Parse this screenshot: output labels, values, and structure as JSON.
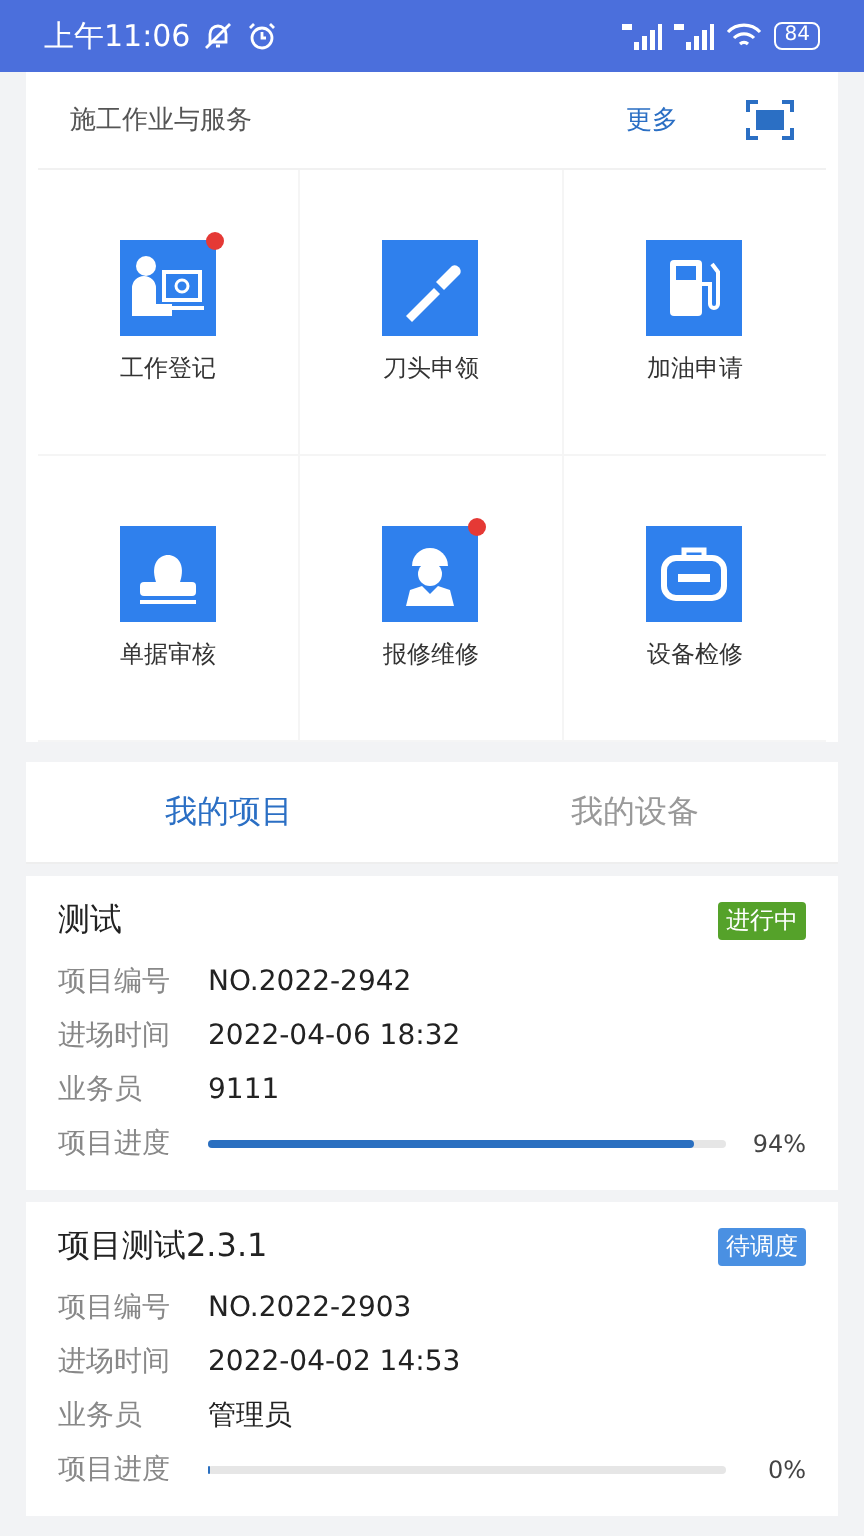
{
  "status_bar": {
    "time": "上午11:06",
    "battery": "84"
  },
  "services": {
    "title": "施工作业与服务",
    "more": "更多",
    "items": [
      {
        "label": "工作登记",
        "badge": true
      },
      {
        "label": "刀头申领",
        "badge": false
      },
      {
        "label": "加油申请",
        "badge": false
      },
      {
        "label": "单据审核",
        "badge": false
      },
      {
        "label": "报修维修",
        "badge": true
      },
      {
        "label": "设备检修",
        "badge": false
      }
    ]
  },
  "tabs": [
    {
      "label": "我的项目",
      "selected": true
    },
    {
      "label": "我的设备",
      "selected": false
    }
  ],
  "projects": [
    {
      "name": "测试",
      "status": "进行中",
      "color": "#55a22a",
      "fields": [
        {
          "label": "项目编号",
          "value": "NO.2022-2942"
        },
        {
          "label": "进场时间",
          "value": "2022-04-06 18:32"
        },
        {
          "label": "业务员",
          "value": "9111"
        }
      ],
      "progress_label": "项目进度",
      "level": 0.94,
      "reading": "94%"
    },
    {
      "name": "项目测试2.3.1",
      "status": "待调度",
      "color": "#4a90e2",
      "fields": [
        {
          "label": "项目编号",
          "value": "NO.2022-2903"
        },
        {
          "label": "进场时间",
          "value": "2022-04-02 14:53"
        },
        {
          "label": "业务员",
          "value": "管理员"
        }
      ],
      "progress_label": "项目进度",
      "level": 0,
      "reading": "0%"
    }
  ]
}
